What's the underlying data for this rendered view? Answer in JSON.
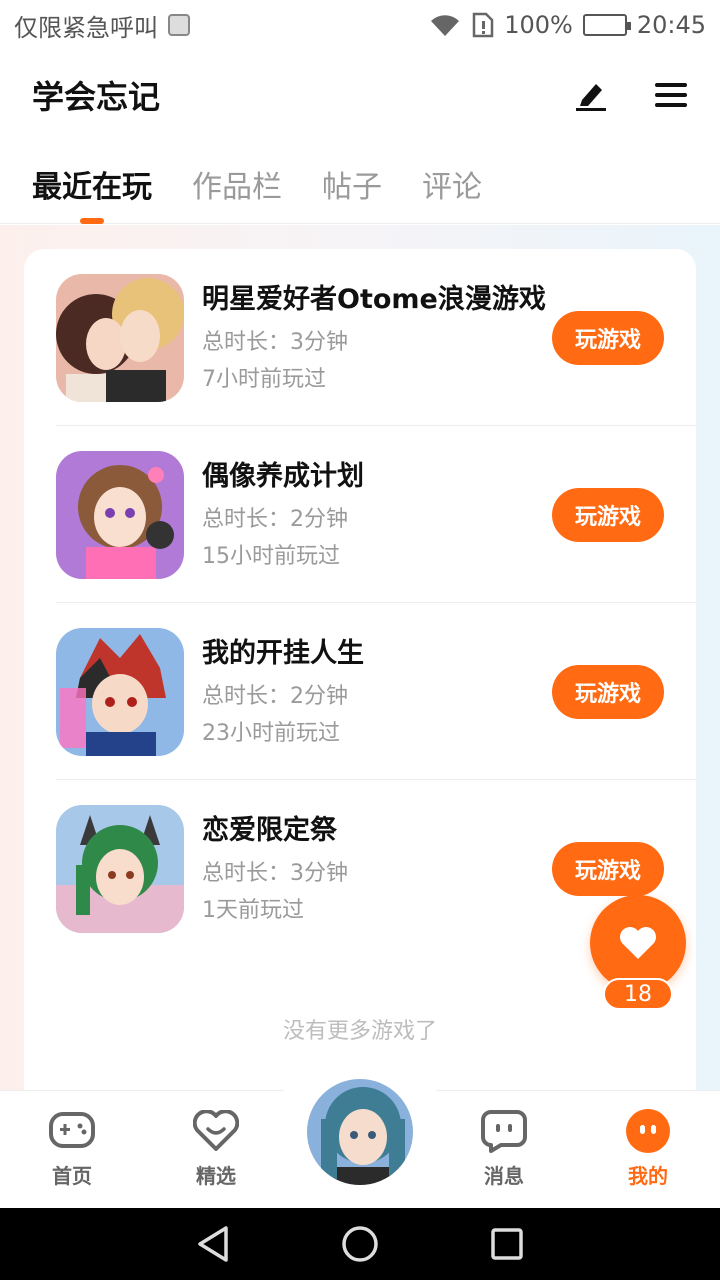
{
  "status_bar": {
    "notice": "仅限紧急呼叫",
    "battery": "100%",
    "time": "20:45"
  },
  "header": {
    "title": "学会忘记",
    "edit_icon": "pen-icon",
    "menu_icon": "hamburger-menu-icon"
  },
  "tabs": [
    {
      "label": "最近在玩",
      "active": true
    },
    {
      "label": "作品栏",
      "active": false
    },
    {
      "label": "帖子",
      "active": false
    },
    {
      "label": "评论",
      "active": false
    }
  ],
  "games": [
    {
      "name": "明星爱好者Otome浪漫游戏",
      "duration": "总时长：3分钟",
      "last_played": "7小时前玩过",
      "button": "玩游戏"
    },
    {
      "name": "偶像养成计划",
      "duration": "总时长：2分钟",
      "last_played": "15小时前玩过",
      "button": "玩游戏"
    },
    {
      "name": "我的开挂人生",
      "duration": "总时长：2分钟",
      "last_played": "23小时前玩过",
      "button": "玩游戏"
    },
    {
      "name": "恋爱限定祭",
      "duration": "总时长：3分钟",
      "last_played": "1天前玩过",
      "button": "玩游戏"
    }
  ],
  "no_more": "没有更多游戏了",
  "like": {
    "count": "18",
    "icon": "heart-icon"
  },
  "bottom_nav": [
    {
      "label": "首页",
      "icon": "gamepad-icon",
      "active": false
    },
    {
      "label": "精选",
      "icon": "heart-chat-icon",
      "active": false
    },
    {
      "label": "消息",
      "icon": "chat-bubble-icon",
      "active": false
    },
    {
      "label": "我的",
      "icon": "profile-face-icon",
      "active": true
    }
  ],
  "colors": {
    "accent": "#ff6a13",
    "muted": "#9a9a9a"
  }
}
